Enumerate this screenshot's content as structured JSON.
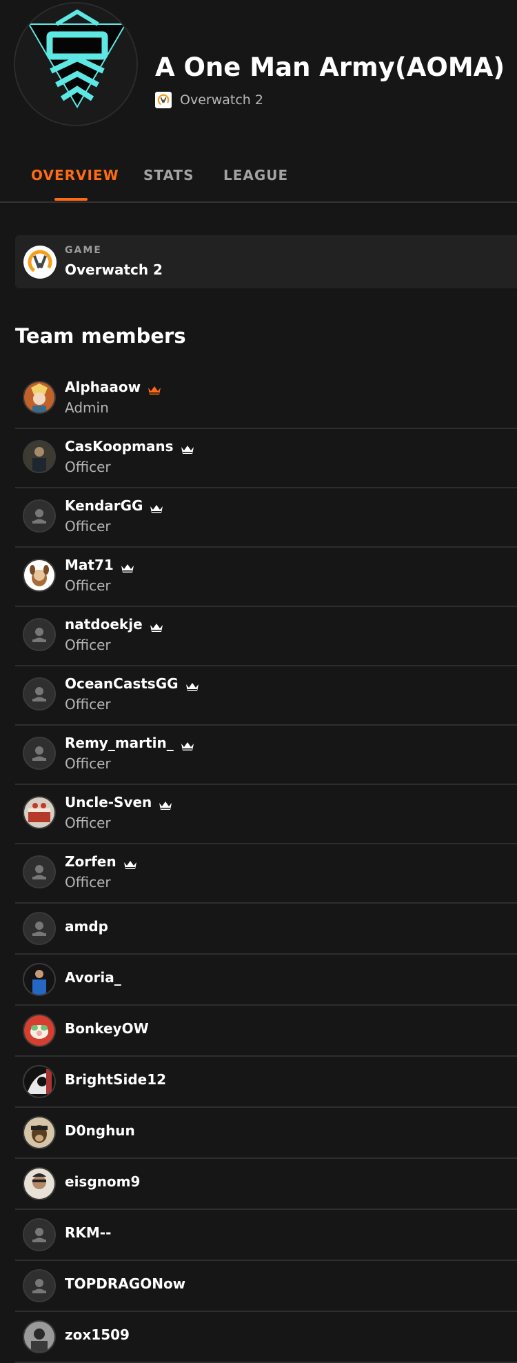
{
  "team": {
    "name": "A One Man Army(AOMA)",
    "game": "Overwatch 2"
  },
  "tabs": [
    {
      "label": "OVERVIEW",
      "active": true
    },
    {
      "label": "STATS",
      "active": false
    },
    {
      "label": "LEAGUE",
      "active": false
    }
  ],
  "game_card": {
    "caption": "GAME",
    "name": "Overwatch 2"
  },
  "members_title": "Team members",
  "members": [
    {
      "name": "Alphaaow",
      "role": "Admin",
      "crown": "admin-crown-icon",
      "avatar": "character"
    },
    {
      "name": "CasKoopmans",
      "role": "Officer",
      "crown": "officer-crown-icon",
      "avatar": "photo"
    },
    {
      "name": "KendarGG",
      "role": "Officer",
      "crown": "officer-crown-icon",
      "avatar": "default"
    },
    {
      "name": "Mat71",
      "role": "Officer",
      "crown": "officer-crown-icon",
      "avatar": "cartoon"
    },
    {
      "name": "natdoekje",
      "role": "Officer",
      "crown": "officer-crown-icon",
      "avatar": "default"
    },
    {
      "name": "OceanCastsGG",
      "role": "Officer",
      "crown": "officer-crown-icon",
      "avatar": "default"
    },
    {
      "name": "Remy_martin_",
      "role": "Officer",
      "crown": "officer-crown-icon",
      "avatar": "default"
    },
    {
      "name": "Uncle-Sven",
      "role": "Officer",
      "crown": "officer-crown-icon",
      "avatar": "cake"
    },
    {
      "name": "Zorfen",
      "role": "Officer",
      "crown": "officer-crown-icon",
      "avatar": "default"
    },
    {
      "name": "amdp",
      "role": "",
      "avatar": "default"
    },
    {
      "name": "Avoria_",
      "role": "",
      "avatar": "photo-blue"
    },
    {
      "name": "BonkeyOW",
      "role": "",
      "avatar": "red-character"
    },
    {
      "name": "BrightSide12",
      "role": "",
      "avatar": "bw-art"
    },
    {
      "name": "D0nghun",
      "role": "",
      "avatar": "dog"
    },
    {
      "name": "eisgnom9",
      "role": "",
      "avatar": "face"
    },
    {
      "name": "RKM--",
      "role": "",
      "avatar": "default"
    },
    {
      "name": "TOPDRAGONow",
      "role": "",
      "avatar": "default"
    },
    {
      "name": "zox1509",
      "role": "",
      "avatar": "bw-photo"
    }
  ],
  "colors": {
    "accent": "#ff6b13",
    "logo_cyan": "#5ee8e4",
    "officer_crown": "#ffffff",
    "background": "#161616"
  }
}
